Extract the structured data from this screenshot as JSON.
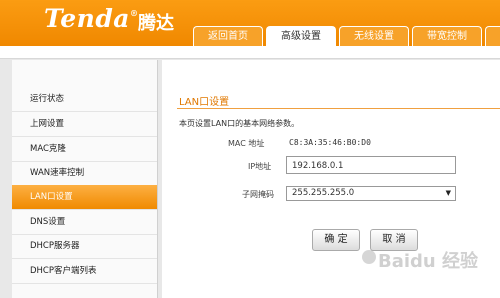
{
  "brand": {
    "logo": "Tenda",
    "registered": "®",
    "name_cn": "腾达"
  },
  "tabs": [
    {
      "label": "返回首页"
    },
    {
      "label": "高级设置"
    },
    {
      "label": "无线设置"
    },
    {
      "label": "带宽控制"
    }
  ],
  "sidebar": {
    "items": [
      {
        "label": "运行状态"
      },
      {
        "label": "上网设置"
      },
      {
        "label": "MAC克隆"
      },
      {
        "label": "WAN速率控制"
      },
      {
        "label": "LAN口设置"
      },
      {
        "label": "DNS设置"
      },
      {
        "label": "DHCP服务器"
      },
      {
        "label": "DHCP客户端列表"
      }
    ]
  },
  "main": {
    "title": "LAN口设置",
    "description": "本页设置LAN口的基本网络参数。",
    "mac_label": "MAC 地址",
    "mac_value": "C8:3A:35:46:B0:D0",
    "ip_label": "IP地址",
    "ip_value": "192.168.0.1",
    "mask_label": "子网掩码",
    "mask_value": "255.255.255.0",
    "ok_label": "确 定",
    "cancel_label": "取 消"
  },
  "watermark": {
    "text": "Baidu 经验"
  },
  "colors": {
    "brand_orange": "#f08800",
    "accent_text": "#e07800"
  }
}
